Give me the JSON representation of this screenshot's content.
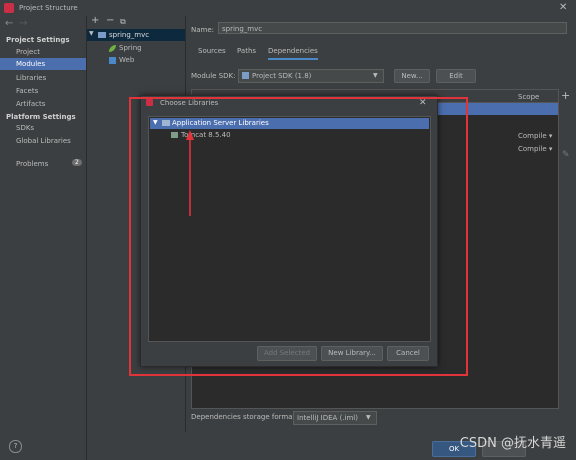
{
  "window": {
    "title": "Project Structure",
    "close": "✕"
  },
  "nav": {
    "back": "←",
    "forward": "→"
  },
  "sidebar": {
    "project_settings_header": "Project Settings",
    "project_items": [
      "Project",
      "Modules",
      "Libraries",
      "Facets",
      "Artifacts"
    ],
    "platform_settings_header": "Platform Settings",
    "platform_items": [
      "SDKs",
      "Global Libraries"
    ],
    "problems_label": "Problems",
    "problems_count": "2",
    "help": "?"
  },
  "tree": {
    "add": "+",
    "remove": "−",
    "copy": "⧉",
    "root": "spring_mvc",
    "children": [
      "Spring",
      "Web"
    ]
  },
  "module": {
    "name_label": "Name:",
    "name_value": "spring_mvc",
    "tabs": [
      "Sources",
      "Paths",
      "Dependencies"
    ],
    "sdk_label": "Module SDK:",
    "sdk_value": "Project SDK (1.8)",
    "new_button": "New...",
    "edit_button": "Edit",
    "scope_header": "Scope",
    "scope_rows": [
      "Compile ▾",
      "Compile ▾"
    ],
    "storage_label": "Dependencies storage format:",
    "storage_value": "IntelliJ IDEA (.iml)"
  },
  "dialog": {
    "title": "Choose Libraries",
    "close": "✕",
    "group": "Application Server Libraries",
    "item": "Tomcat 8.5.40",
    "add_selected": "Add Selected",
    "new_library": "New Library...",
    "cancel": "Cancel"
  },
  "footer": {
    "ok": "OK"
  },
  "watermark": "CSDN @抚水青遥",
  "colors": {
    "selection": "#4b6eaf",
    "highlight_box": "#e0343a",
    "arrow": "#e0343a",
    "spring_leaf": "#6db33f",
    "web_icon": "#4a88c7"
  }
}
